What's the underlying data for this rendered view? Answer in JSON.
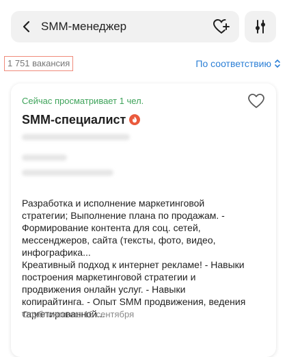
{
  "search": {
    "query": "SMM-менеджер",
    "back_icon": "chevron-left-icon",
    "save_search_icon": "heart-plus-icon",
    "filter_icon": "sliders-icon"
  },
  "results": {
    "count_label": "1 751 вакансия",
    "sort_label": "По соответствию",
    "sort_icon": "chevron-up-down-icon"
  },
  "vacancy": {
    "viewing": "Сейчас просматривает 1 чел.",
    "title": "SMM-специалист",
    "hot_icon": "fire-icon",
    "hot_color": "#ea5a3d",
    "favorite_icon": "heart-outline-icon",
    "description": "Разработка и исполнение маркетинговой\nстратегии; Выполнение плана по продажам. -\nФормирование контента для соц. сетей,\nмессенджеров, сайта (тексты, фото, видео,\nинфографика...\nКреативный подход к интернет рекламе! - Навыки\nпостроения маркетинговой стратегии и\nпродвижения онлайн услуг. - Навыки\nкопирайтинга. - Опыт SMM продвижения, ведения\nтаргетированной...",
    "published": "Опубликовано 16 сентября"
  },
  "colors": {
    "accent_link": "#2b7fd6",
    "viewing_green": "#3ea35a",
    "highlight_border": "#f08a7a"
  }
}
